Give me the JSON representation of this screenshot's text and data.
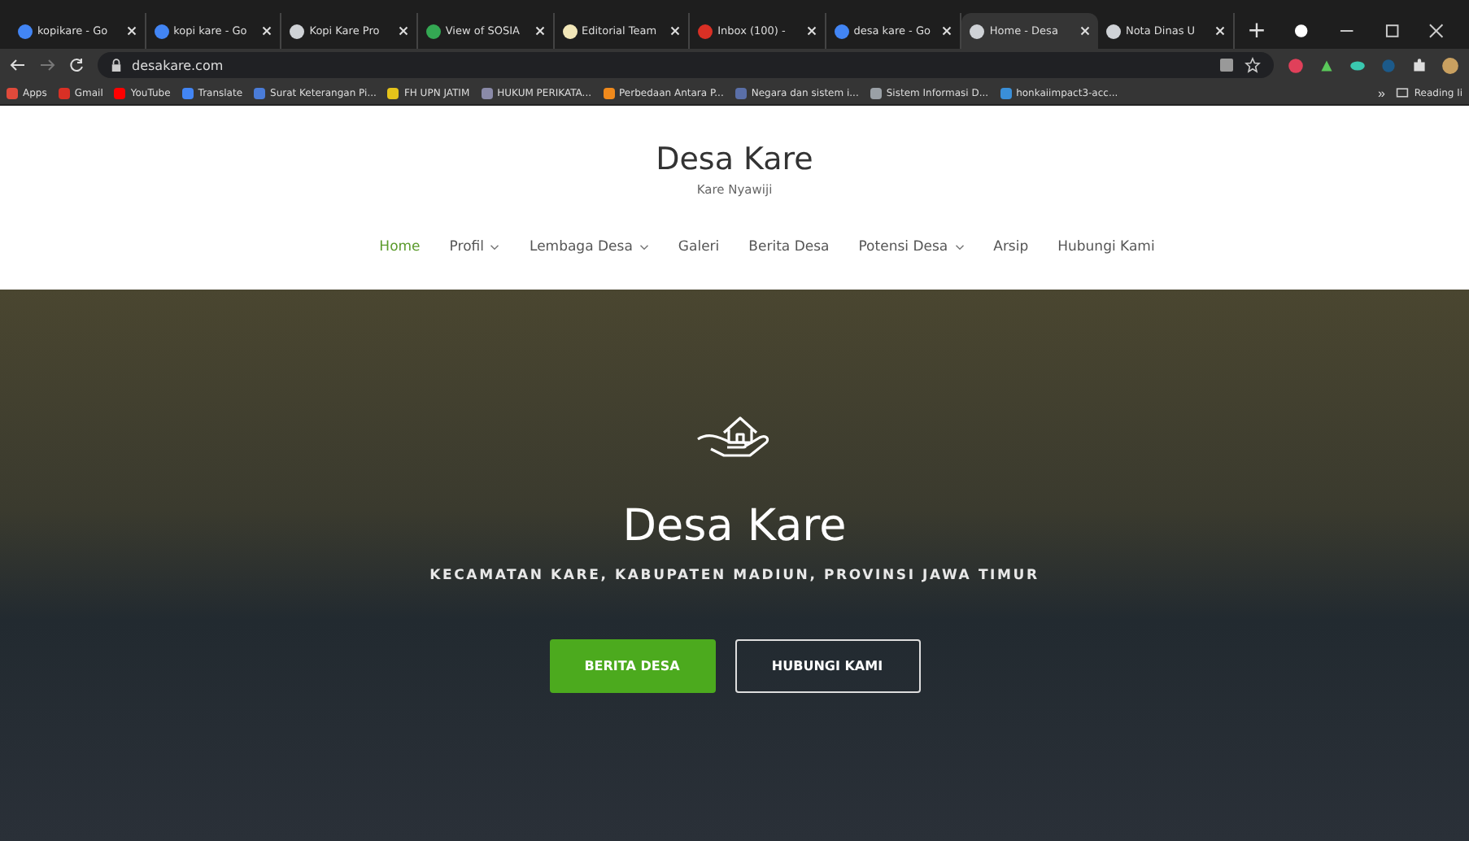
{
  "browser": {
    "tabs": [
      {
        "label": "kopikare - Go",
        "color": "#4285f4",
        "selected": false
      },
      {
        "label": "kopi kare - Go",
        "color": "#4285f4",
        "selected": false
      },
      {
        "label": "Kopi Kare Pro",
        "color": "#cfd2d6",
        "selected": false
      },
      {
        "label": "View of SOSIA",
        "color": "#34a853",
        "selected": false
      },
      {
        "label": "Editorial Team",
        "color": "#f1e6b8",
        "selected": false
      },
      {
        "label": "Inbox (100) -",
        "color": "#d93025",
        "selected": false
      },
      {
        "label": "desa kare - Go",
        "color": "#4285f4",
        "selected": false
      },
      {
        "label": "Home - Desa",
        "color": "#cfd2d6",
        "selected": true
      },
      {
        "label": "Nota Dinas U",
        "color": "#cfd2d6",
        "selected": false
      }
    ],
    "new_tab": "+",
    "url": "desakare.com",
    "bookmarks": [
      {
        "label": "Apps",
        "color": "#e04a3b"
      },
      {
        "label": "Gmail",
        "color": "#d93025"
      },
      {
        "label": "YouTube",
        "color": "#ff0000"
      },
      {
        "label": "Translate",
        "color": "#4285f4"
      },
      {
        "label": "Surat Keterangan Pi...",
        "color": "#4a7cd8"
      },
      {
        "label": "FH UPN JATIM",
        "color": "#e5c31a"
      },
      {
        "label": "HUKUM PERIKATA...",
        "color": "#8a8aa8"
      },
      {
        "label": "Perbedaan Antara P...",
        "color": "#f08a1c"
      },
      {
        "label": "Negara dan sistem i...",
        "color": "#5a6fa8"
      },
      {
        "label": "Sistem Informasi D...",
        "color": "#9aa0a6"
      },
      {
        "label": "honkaiimpact3-acc...",
        "color": "#3a8fd8"
      }
    ],
    "more": "»",
    "reading_list": "Reading li"
  },
  "site": {
    "title": "Desa Kare",
    "tagline": "Kare Nyawiji",
    "nav": [
      {
        "label": "Home",
        "selected": true,
        "dropdown": false
      },
      {
        "label": "Profil",
        "selected": false,
        "dropdown": true
      },
      {
        "label": "Lembaga Desa",
        "selected": false,
        "dropdown": true
      },
      {
        "label": "Galeri",
        "selected": false,
        "dropdown": false
      },
      {
        "label": "Berita Desa",
        "selected": false,
        "dropdown": false
      },
      {
        "label": "Potensi Desa",
        "selected": false,
        "dropdown": true
      },
      {
        "label": "Arsip",
        "selected": false,
        "dropdown": false
      },
      {
        "label": "Hubungi Kami",
        "selected": false,
        "dropdown": false
      }
    ]
  },
  "hero": {
    "title": "Desa Kare",
    "subtitle": "KECAMATAN KARE, KABUPATEN MADIUN, PROVINSI JAWA TIMUR",
    "buttons": [
      {
        "label": "BERITA DESA",
        "kind": "primary"
      },
      {
        "label": "HUBUNGI KAMI",
        "kind": "outline"
      }
    ]
  }
}
